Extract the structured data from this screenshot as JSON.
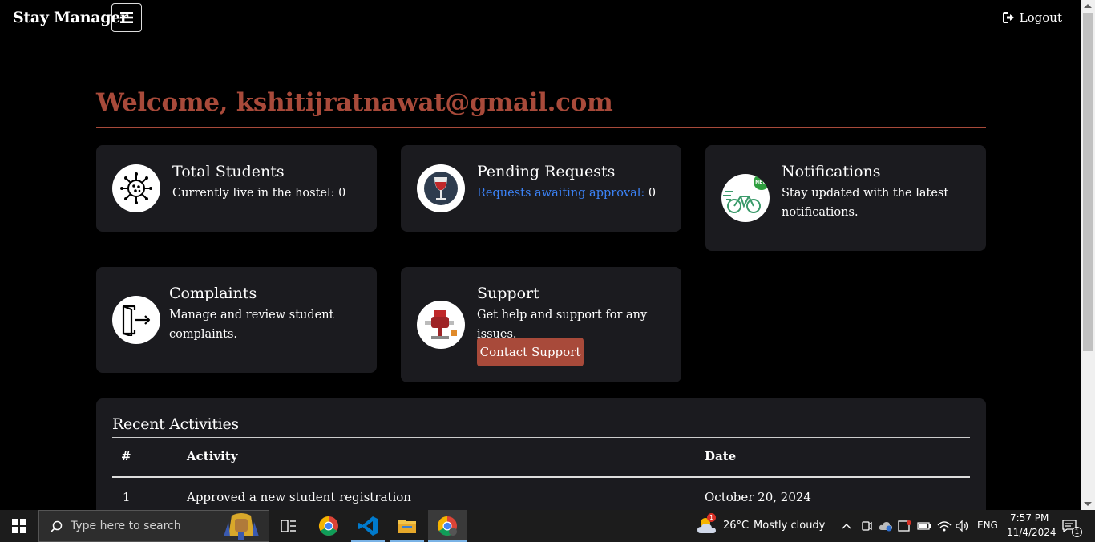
{
  "nav": {
    "brand": "Stay Manager",
    "logout_label": "Logout"
  },
  "welcome": "Welcome, kshitijratnawat@gmail.com",
  "cards": {
    "total_students": {
      "title": "Total Students",
      "label": "Currently live in the hostel:",
      "value": "0"
    },
    "pending_requests": {
      "title": "Pending Requests",
      "label": "Requests awaiting approval:",
      "value": "0"
    },
    "notifications": {
      "title": "Notifications",
      "text_line1": "Stay updated with the latest",
      "text_line2": "notifications.",
      "badge": "NEW"
    },
    "complaints": {
      "title": "Complaints",
      "text_line1": "Manage and review student",
      "text_line2": "complaints."
    },
    "support": {
      "title": "Support",
      "text": "Get help and support for any issues.",
      "button": "Contact Support"
    }
  },
  "activities": {
    "title": "Recent Activities",
    "headers": [
      "#",
      "Activity",
      "Date"
    ],
    "rows": [
      {
        "num": "1",
        "activity": "Approved a new student registration",
        "date": "October 20, 2024"
      }
    ]
  },
  "taskbar": {
    "search_placeholder": "Type here to search",
    "weather_temp": "26°C",
    "weather_text": "Mostly cloudy",
    "language": "ENG",
    "time": "7:57 PM",
    "date": "11/4/2024",
    "notification_count": "1",
    "weather_badge": "1"
  },
  "colors": {
    "accent": "#a84a3a",
    "card_bg": "#1b1b1f",
    "link_blue": "#3b82f6",
    "background": "#000000"
  }
}
